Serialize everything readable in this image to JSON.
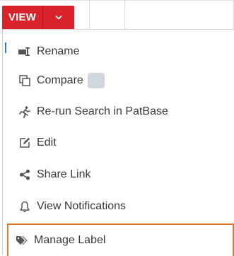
{
  "button": {
    "label": "VIEW"
  },
  "menu": {
    "items": [
      {
        "label": "Rename",
        "icon": "rename-icon"
      },
      {
        "label": "Compare",
        "icon": "compare-icon"
      },
      {
        "label": "Re-run Search in PatBase",
        "icon": "running-person-icon"
      },
      {
        "label": "Edit",
        "icon": "edit-icon"
      },
      {
        "label": "Share Link",
        "icon": "share-icon"
      },
      {
        "label": "View Notifications",
        "icon": "bell-icon"
      },
      {
        "label": "Manage Label",
        "icon": "tag-icon"
      }
    ]
  },
  "colors": {
    "button_red": "#d9222a",
    "highlight_border": "#e07b30",
    "icon_color": "#555555"
  }
}
